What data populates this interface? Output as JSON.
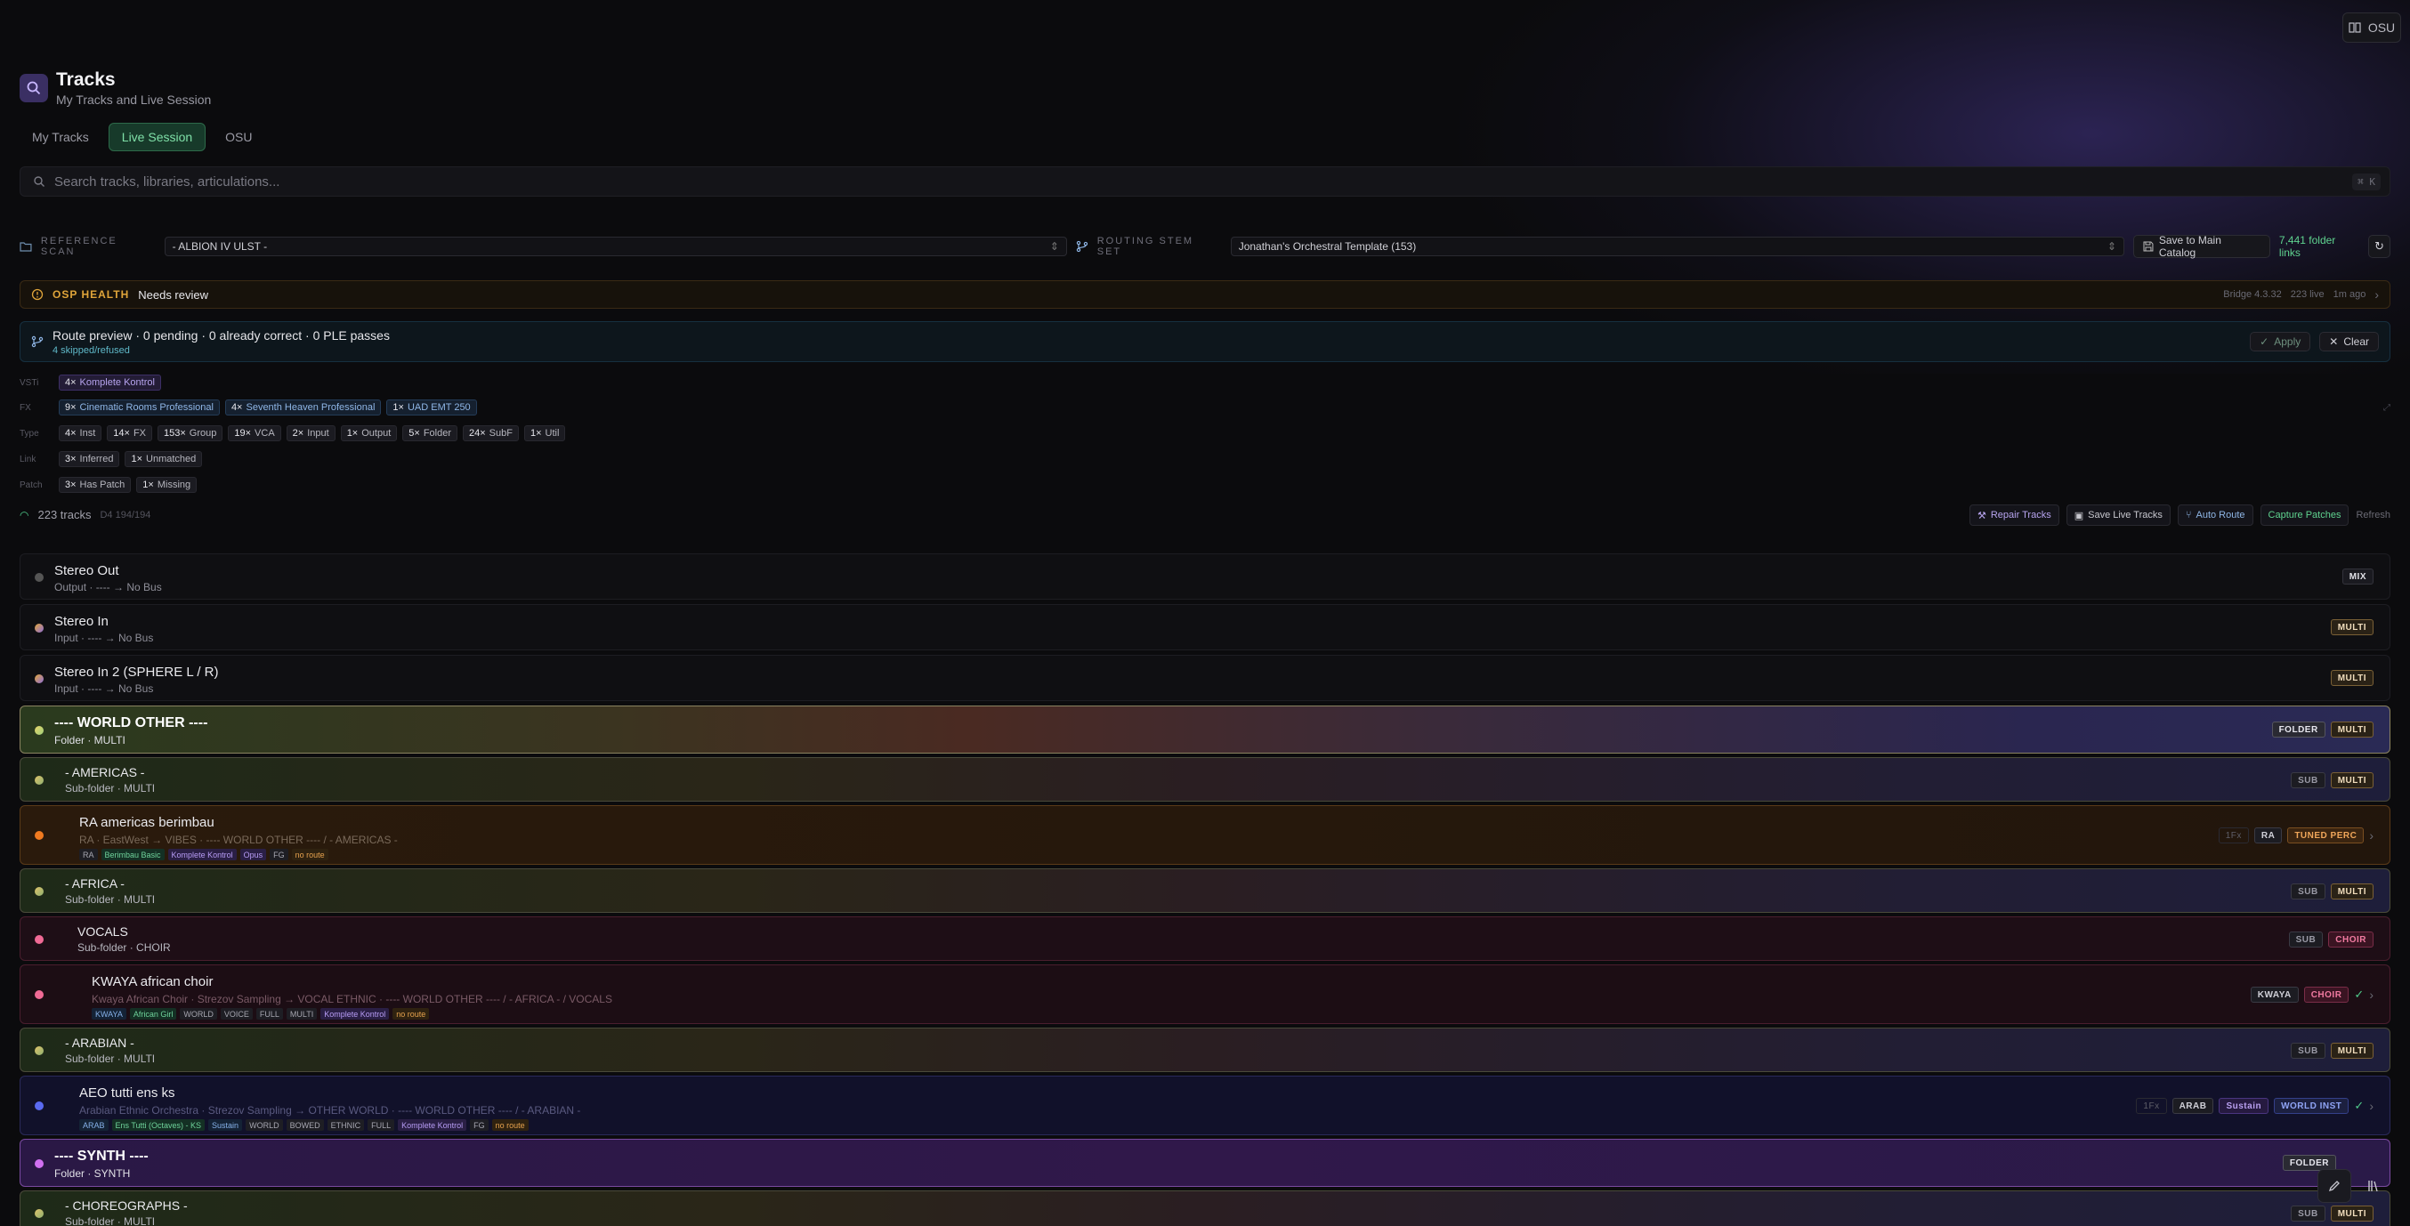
{
  "topbar": {
    "osu_label": "OSU"
  },
  "header": {
    "title": "Tracks",
    "subtitle": "My Tracks and Live Session"
  },
  "tabs": [
    {
      "label": "My Tracks",
      "active": false
    },
    {
      "label": "Live Session",
      "active": true
    },
    {
      "label": "OSU",
      "active": false
    }
  ],
  "search": {
    "placeholder": "Search tracks, libraries, articulations...",
    "shortcut": "⌘ K"
  },
  "reference": {
    "scan_label": "REFERENCE SCAN",
    "scan_value": "- ALBION IV ULST -",
    "stem_label": "ROUTING STEM SET",
    "stem_value": "Jonathan's Orchestral Template (153)",
    "save_label": "Save to Main Catalog",
    "folder_links": "7,441 folder links"
  },
  "health": {
    "label": "OSP HEALTH",
    "status": "Needs review",
    "bridge": "Bridge 4.3.32",
    "live": "223 live",
    "ago": "1m ago"
  },
  "route": {
    "title": "Route preview · 0 pending · 0 already correct · 0 PLE passes",
    "sub": "4 skipped/refused",
    "apply": "Apply",
    "clear": "Clear"
  },
  "filters": {
    "vsti": {
      "label": "VSTi",
      "chips": [
        {
          "n": "4×",
          "t": "Komplete Kontrol",
          "c": "purple"
        }
      ]
    },
    "fx": {
      "label": "FX",
      "chips": [
        {
          "n": "9×",
          "t": "Cinematic Rooms Professional",
          "c": "blue"
        },
        {
          "n": "4×",
          "t": "Seventh Heaven Professional",
          "c": "blue"
        },
        {
          "n": "1×",
          "t": "UAD EMT 250",
          "c": "blue"
        }
      ]
    },
    "type": {
      "label": "Type",
      "chips": [
        {
          "n": "4×",
          "t": "Inst"
        },
        {
          "n": "14×",
          "t": "FX"
        },
        {
          "n": "153×",
          "t": "Group"
        },
        {
          "n": "19×",
          "t": "VCA"
        },
        {
          "n": "2×",
          "t": "Input"
        },
        {
          "n": "1×",
          "t": "Output"
        },
        {
          "n": "5×",
          "t": "Folder"
        },
        {
          "n": "24×",
          "t": "SubF"
        },
        {
          "n": "1×",
          "t": "Util"
        }
      ]
    },
    "link": {
      "label": "Link",
      "chips": [
        {
          "n": "3×",
          "t": "Inferred"
        },
        {
          "n": "1×",
          "t": "Unmatched"
        }
      ]
    },
    "patch": {
      "label": "Patch",
      "chips": [
        {
          "n": "3×",
          "t": "Has Patch"
        },
        {
          "n": "1×",
          "t": "Missing"
        }
      ]
    }
  },
  "stats": {
    "count": "223 tracks",
    "extra": "D4 194/194"
  },
  "actions": {
    "repair": "Repair Tracks",
    "save_live": "Save Live Tracks",
    "auto_route": "Auto Route",
    "capture": "Capture Patches",
    "refresh": "Refresh"
  },
  "tracks": [
    {
      "name": "Stereo Out",
      "sub": "Output · ---- → No Bus",
      "badges": [
        "MIX"
      ]
    },
    {
      "name": "Stereo In",
      "sub": "Input · ---- → No Bus",
      "badges": [
        "MULTI"
      ]
    },
    {
      "name": "Stereo In 2 (SPHERE L / R)",
      "sub": "Input · ---- → No Bus",
      "badges": [
        "MULTI"
      ]
    },
    {
      "name": "---- WORLD OTHER ----",
      "sub": "Folder · MULTI",
      "badges": [
        "FOLDER",
        "MULTI"
      ]
    },
    {
      "name": "- AMERICAS -",
      "sub": "Sub-folder · MULTI",
      "badges": [
        "SUB",
        "MULTI"
      ]
    },
    {
      "name": "RA americas berimbau",
      "sub": "RA · EastWest → VIBES · ---- WORLD OTHER ---- / - AMERICAS -",
      "tags": [
        "RA",
        "Berimbau Basic",
        "Komplete Kontrol",
        "Opus",
        "FG",
        "no route"
      ],
      "badges": [
        "1Fx",
        "RA",
        "TUNED PERC"
      ]
    },
    {
      "name": "- AFRICA -",
      "sub": "Sub-folder · MULTI",
      "badges": [
        "SUB",
        "MULTI"
      ]
    },
    {
      "name": "VOCALS",
      "sub": "Sub-folder · CHOIR",
      "badges": [
        "SUB",
        "CHOIR"
      ]
    },
    {
      "name": "KWAYA african choir",
      "sub": "Kwaya African Choir · Strezov Sampling → VOCAL ETHNIC · ---- WORLD OTHER ---- / - AFRICA - / VOCALS",
      "tags": [
        "KWAYA",
        "African Girl",
        "WORLD",
        "VOICE",
        "FULL",
        "MULTI",
        "Komplete Kontrol",
        "no route"
      ],
      "badges": [
        "KWAYA",
        "CHOIR"
      ]
    },
    {
      "name": "- ARABIAN -",
      "sub": "Sub-folder · MULTI",
      "badges": [
        "SUB",
        "MULTI"
      ]
    },
    {
      "name": "AEO tutti ens ks",
      "sub": "Arabian Ethnic Orchestra · Strezov Sampling → OTHER WORLD · ---- WORLD OTHER ---- / - ARABIAN -",
      "tags": [
        "ARAB",
        "Ens Tutti (Octaves) - KS",
        "Sustain",
        "WORLD",
        "BOWED",
        "ETHNIC",
        "FULL",
        "Komplete Kontrol",
        "FG",
        "no route"
      ],
      "badges": [
        "1Fx",
        "ARAB",
        "Sustain",
        "WORLD INST"
      ]
    },
    {
      "name": "---- SYNTH ----",
      "sub": "Folder · SYNTH",
      "badges": [
        "FOLDER"
      ]
    },
    {
      "name": "- CHOREOGRAPHS -",
      "sub": "Sub-folder · MULTI",
      "badges": [
        "SUB",
        "MULTI"
      ]
    }
  ],
  "colors": {
    "accent_green": "#7fe0a8",
    "purple": "#3a2f63",
    "warning": "#e0a53a"
  }
}
